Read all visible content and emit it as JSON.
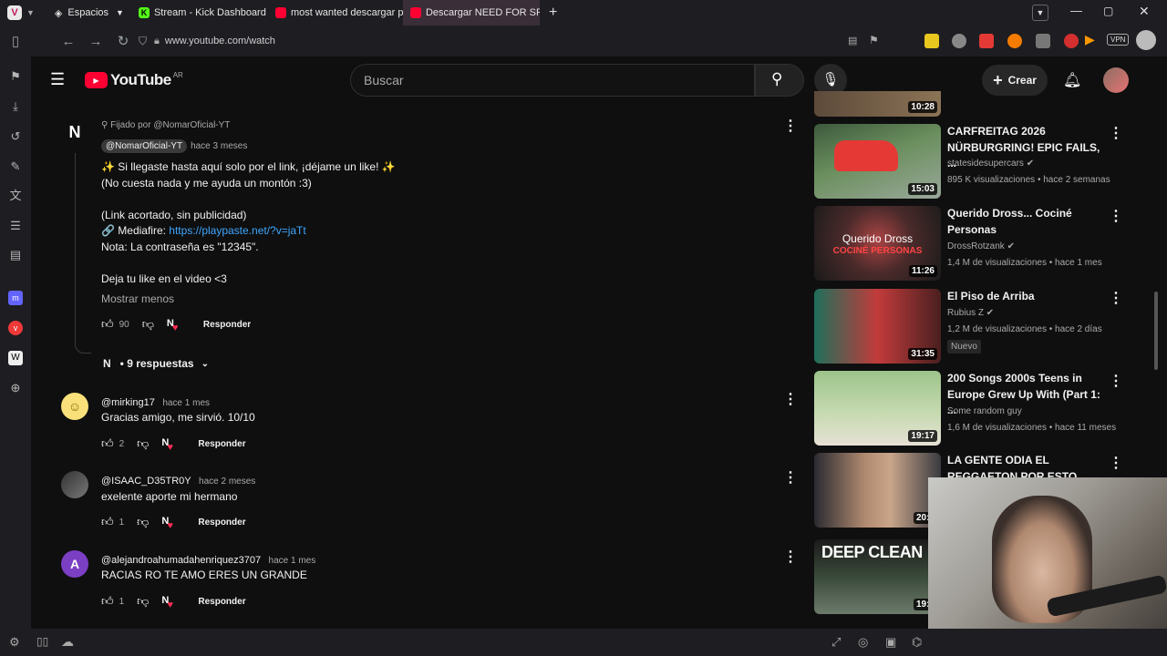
{
  "browser": {
    "workspace_label": "Espacios",
    "tabs": [
      {
        "label": "Stream - Kick Dashboard",
        "color": "#53fc18"
      },
      {
        "label": "most wanted descargar pa",
        "color": "#ff0033"
      },
      {
        "label": "Descargar NEED FOR SPEE",
        "color": "#ff0033"
      }
    ],
    "url": "www.youtube.com/watch"
  },
  "youtube": {
    "logo_text": "YouTube",
    "country": "AR",
    "search_placeholder": "Buscar",
    "create_label": "Crear"
  },
  "pinned_comment": {
    "pinned_by": "Fijado por @NomarOficial-YT",
    "author": "@NomarOficial-YT",
    "time": "hace 3 meses",
    "line1": "✨ Si llegaste hasta aquí solo por el link, ¡déjame un like! ✨",
    "line2": "(No cuesta nada y me ayuda un montón :3)",
    "line3": "(Link acortado, sin publicidad)",
    "line4_prefix": "🔗 Mediafire: ",
    "line4_link": "https://playpaste.net/?v=jaTt",
    "line5": "Nota: La contraseña es \"12345\".",
    "line6": "Deja tu like en el video <3",
    "show_less": "Mostrar menos",
    "likes": "90",
    "reply_label": "Responder",
    "replies_label": "• 9 respuestas"
  },
  "comments": [
    {
      "author": "@mirking17",
      "time": "hace 1 mes",
      "text": "Gracias amigo, me sirvió. 10/10",
      "likes": "2",
      "reply_label": "Responder"
    },
    {
      "author": "@ISAAC_D35TR0Y",
      "time": "hace 2 meses",
      "text": "exelente aporte mi hermano",
      "likes": "1",
      "reply_label": "Responder"
    },
    {
      "author": "@alejandroahumadahenriquez3707",
      "time": "hace 1 mes",
      "text": "RACIAS RO TE AMO ERES UN GRANDE",
      "likes": "1",
      "reply_label": "Responder",
      "avatar_letter": "A"
    }
  ],
  "videos": [
    {
      "title": "CARFREITAG 2026 NÜRBURGRING! EPIC FAILS, ...",
      "channel": "statesidesupercars",
      "meta": "895 K visualizaciones • hace 2 semanas",
      "duration": "15:03"
    },
    {
      "title": "Querido Dross... Cociné Personas",
      "channel": "DrossRotzank",
      "meta": "1,4 M de visualizaciones • hace 1 mes",
      "duration": "11:26",
      "thumb_text": "Querido Dross",
      "thumb_text2": "COCINÉ PERSONAS"
    },
    {
      "title": "El Piso de Arriba",
      "channel": "Rubius Z",
      "meta": "1,2 M de visualizaciones • hace 2 días",
      "duration": "31:35",
      "badge": "Nuevo"
    },
    {
      "title": "200 Songs 2000s Teens in Europe Grew Up With (Part 1: ...",
      "channel": "Some random guy",
      "meta": "1,6 M de visualizaciones • hace 11 meses",
      "duration": "19:17"
    },
    {
      "title": "LA GENTE ODIA EL REGGAETON POR ESTO",
      "duration": "20:1"
    },
    {
      "duration": "19:1",
      "thumb_text": "DEEP CLEAN"
    }
  ],
  "top_thumb_duration": "10:28"
}
